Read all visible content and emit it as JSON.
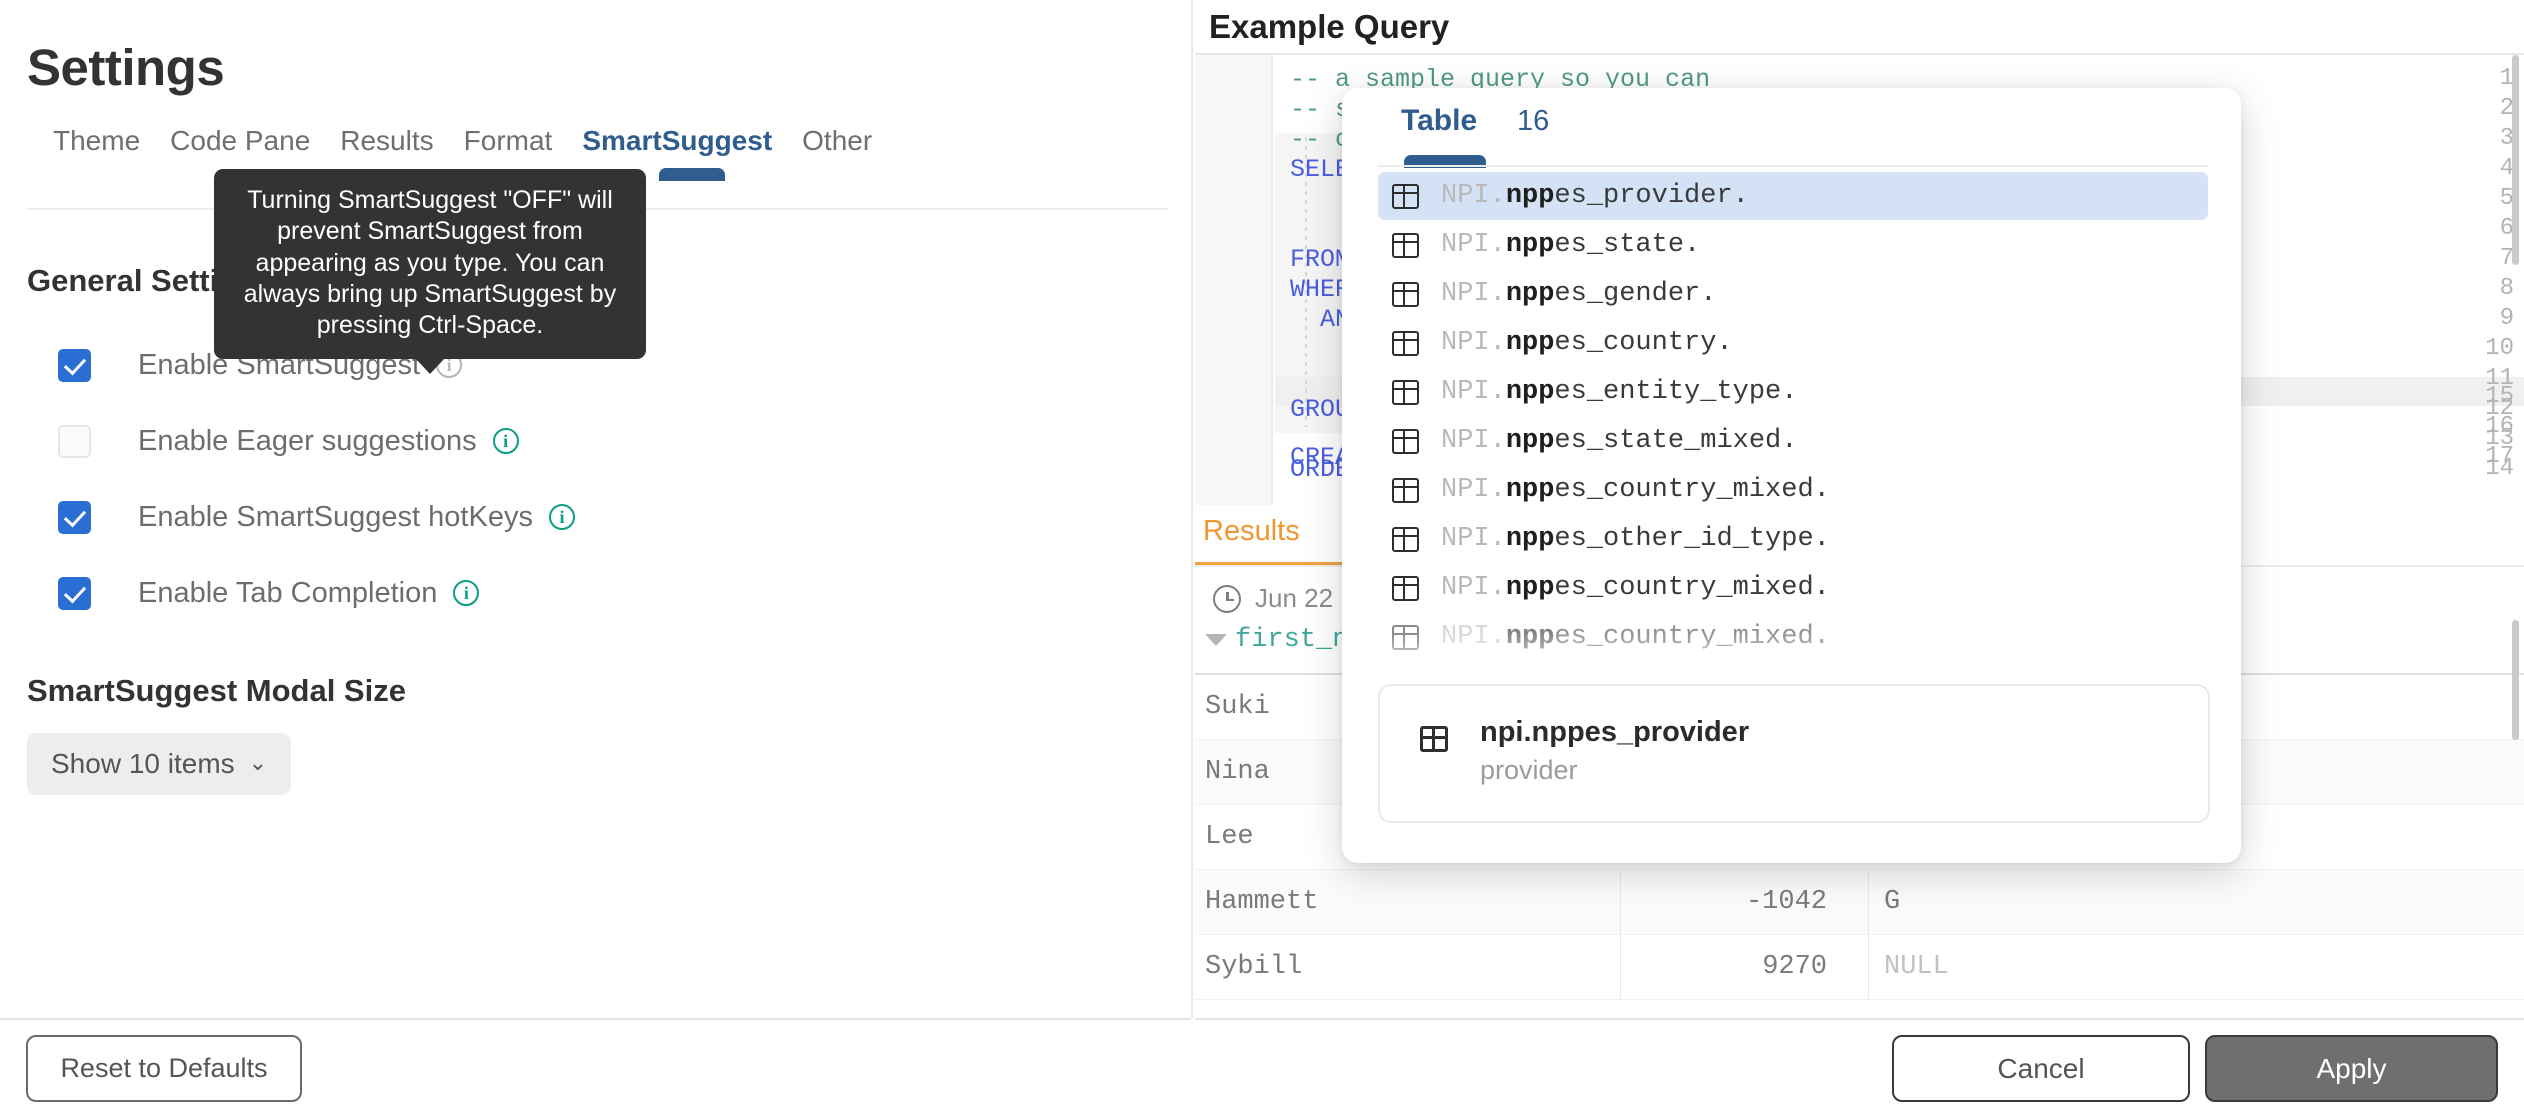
{
  "settings": {
    "title": "Settings",
    "tabs": [
      {
        "label": "Theme",
        "active": false
      },
      {
        "label": "Code Pane",
        "active": false
      },
      {
        "label": "Results",
        "active": false
      },
      {
        "label": "Format",
        "active": false
      },
      {
        "label": "SmartSuggest",
        "active": true
      },
      {
        "label": "Other",
        "active": false
      }
    ],
    "general_heading": "General Settings",
    "checkboxes": [
      {
        "label": "Enable SmartSuggest",
        "checked": true,
        "info_muted": true
      },
      {
        "label": "Enable Eager suggestions",
        "checked": false,
        "info_muted": false
      },
      {
        "label": "Enable SmartSuggest hotKeys",
        "checked": true,
        "info_muted": false
      },
      {
        "label": "Enable Tab Completion",
        "checked": true,
        "info_muted": false
      }
    ],
    "modal_size_heading": "SmartSuggest Modal Size",
    "modal_size_value": "Show 10 items",
    "tooltip": "Turning SmartSuggest \"OFF\" will prevent SmartSuggest from appearing as you type. You can always bring up SmartSuggest by pressing Ctrl-Space.",
    "accent_color": "#2f5d8e",
    "checkbox_color": "#2a6ed4",
    "info_color": "#0a9e84"
  },
  "footer": {
    "reset_label": "Reset to Defaults",
    "cancel_label": "Cancel",
    "apply_label": "Apply"
  },
  "editor": {
    "title": "Example Query",
    "lines": [
      {
        "n": "1",
        "text": "-- a sample query so you can",
        "kind": "comment"
      },
      {
        "n": "2",
        "text": "-- se",
        "kind": "comment"
      },
      {
        "n": "3",
        "text": "-- c",
        "kind": "comment"
      },
      {
        "n": "4",
        "text": "SELE",
        "kind": "keyword"
      },
      {
        "n": "5",
        "text": "",
        "kind": "plain"
      },
      {
        "n": "6",
        "text": "",
        "kind": "plain"
      },
      {
        "n": "7",
        "text": "FROM",
        "kind": "keyword"
      },
      {
        "n": "8",
        "text": "WHER",
        "kind": "keyword"
      },
      {
        "n": "9",
        "text": "  AN",
        "kind": "keyword"
      },
      {
        "n": "10",
        "text": "",
        "kind": "plain"
      },
      {
        "n": "11",
        "text": "",
        "kind": "plain"
      },
      {
        "n": "12",
        "text": "GROU",
        "kind": "keyword"
      },
      {
        "n": "13",
        "text": "",
        "kind": "plain"
      },
      {
        "n": "14",
        "text": "ORDE",
        "kind": "keyword"
      },
      {
        "n": "15",
        "text": "",
        "kind": "plain"
      },
      {
        "n": "16",
        "text": "",
        "kind": "plain"
      },
      {
        "n": "17",
        "text": "CREA",
        "kind": "keyword"
      }
    ]
  },
  "results": {
    "tab_label": "Results",
    "timestamp": "Jun 22",
    "column_header": "first_n",
    "rows": [
      {
        "name": "Suki",
        "num": "",
        "last": ""
      },
      {
        "name": "Nina",
        "num": "",
        "last": ""
      },
      {
        "name": "Lee",
        "num": "",
        "last": ""
      },
      {
        "name": "Hammett",
        "num": "-1042",
        "last": "G"
      },
      {
        "name": "Sybill",
        "num": "9270",
        "last": "NULL"
      }
    ]
  },
  "autocomplete": {
    "header_label": "Table",
    "header_count": "16",
    "items": [
      {
        "prefix": "NPI.",
        "match": "npp",
        "rest": "es_provider.",
        "selected": true,
        "faded": false
      },
      {
        "prefix": "NPI.",
        "match": "npp",
        "rest": "es_state.",
        "selected": false,
        "faded": false
      },
      {
        "prefix": "NPI.",
        "match": "npp",
        "rest": "es_gender.",
        "selected": false,
        "faded": false
      },
      {
        "prefix": "NPI.",
        "match": "npp",
        "rest": "es_country.",
        "selected": false,
        "faded": false
      },
      {
        "prefix": "NPI.",
        "match": "npp",
        "rest": "es_entity_type.",
        "selected": false,
        "faded": false
      },
      {
        "prefix": "NPI.",
        "match": "npp",
        "rest": "es_state_mixed.",
        "selected": false,
        "faded": false
      },
      {
        "prefix": "NPI.",
        "match": "npp",
        "rest": "es_country_mixed.",
        "selected": false,
        "faded": false
      },
      {
        "prefix": "NPI.",
        "match": "npp",
        "rest": "es_other_id_type.",
        "selected": false,
        "faded": false
      },
      {
        "prefix": "NPI.",
        "match": "npp",
        "rest": "es_country_mixed.",
        "selected": false,
        "faded": false
      },
      {
        "prefix": "NPI.",
        "match": "npp",
        "rest": "es_country_mixed.",
        "selected": false,
        "faded": true
      }
    ],
    "detail_title": "npi.nppes_provider",
    "detail_subtitle": "provider"
  }
}
